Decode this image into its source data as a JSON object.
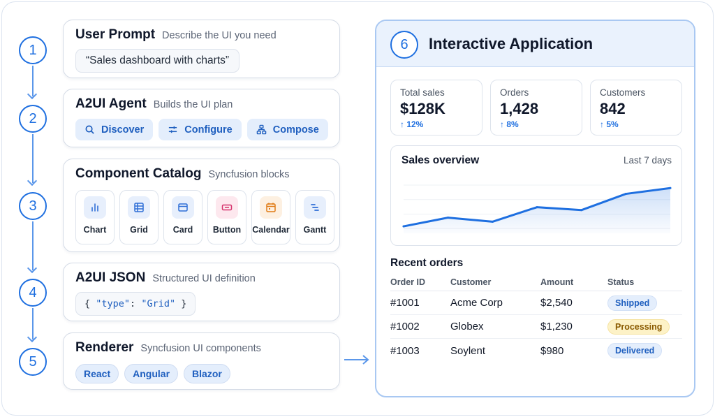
{
  "steps": [
    "1",
    "2",
    "3",
    "4",
    "5",
    "6"
  ],
  "user_prompt": {
    "title": "User Prompt",
    "subtitle": "Describe the UI you need",
    "prompt": "“Sales dashboard with charts”"
  },
  "agent": {
    "title": "A2UI Agent",
    "subtitle": "Builds the UI plan",
    "actions": [
      {
        "label": "Discover",
        "icon": "search-icon"
      },
      {
        "label": "Configure",
        "icon": "sliders-icon"
      },
      {
        "label": "Compose",
        "icon": "hierarchy-icon"
      }
    ]
  },
  "catalog": {
    "title": "Component Catalog",
    "subtitle": "Syncfusion blocks",
    "items": [
      {
        "label": "Chart",
        "icon": "bar-chart-icon",
        "color": "#2f6fd6",
        "bg": "#e7effc"
      },
      {
        "label": "Grid",
        "icon": "table-icon",
        "color": "#2f6fd6",
        "bg": "#e7effc"
      },
      {
        "label": "Card",
        "icon": "card-icon",
        "color": "#2f6fd6",
        "bg": "#e7effc"
      },
      {
        "label": "Button",
        "icon": "button-icon",
        "color": "#d6336c",
        "bg": "#fde8ee"
      },
      {
        "label": "Calendar",
        "icon": "calendar-icon",
        "color": "#e07b15",
        "bg": "#fdf0e1"
      },
      {
        "label": "Gantt",
        "icon": "gantt-icon",
        "color": "#2f6fd6",
        "bg": "#e7effc"
      }
    ]
  },
  "json_step": {
    "title": "A2UI JSON",
    "subtitle": "Structured UI definition",
    "code_open": "{ ",
    "code_key": "\"type\"",
    "code_colon": ": ",
    "code_value": "\"Grid\"",
    "code_close": " }"
  },
  "renderer": {
    "title": "Renderer",
    "subtitle": "Syncfusion UI components",
    "frameworks": [
      "React",
      "Angular",
      "Blazor"
    ]
  },
  "app": {
    "title": "Interactive Application",
    "kpis": [
      {
        "label": "Total sales",
        "value": "$128K",
        "delta": "↑ 12%"
      },
      {
        "label": "Orders",
        "value": "1,428",
        "delta": "↑ 8%"
      },
      {
        "label": "Customers",
        "value": "842",
        "delta": "↑ 5%"
      }
    ],
    "sales_chart": {
      "title": "Sales overview",
      "range": "Last 7 days"
    },
    "orders": {
      "title": "Recent orders",
      "columns": [
        "Order ID",
        "Customer",
        "Amount",
        "Status"
      ],
      "rows": [
        {
          "id": "#1001",
          "customer": "Acme Corp",
          "amount": "$2,540",
          "status": "Shipped",
          "status_color": "blue"
        },
        {
          "id": "#1002",
          "customer": "Globex",
          "amount": "$1,230",
          "status": "Processing",
          "status_color": "yellow"
        },
        {
          "id": "#1003",
          "customer": "Soylent",
          "amount": "$980",
          "status": "Delivered",
          "status_color": "blue"
        }
      ]
    }
  },
  "chart_data": {
    "type": "area",
    "title": "Sales overview",
    "x": [
      1,
      2,
      3,
      4,
      5,
      6,
      7
    ],
    "values": [
      12,
      27,
      20,
      45,
      40,
      68,
      78
    ],
    "ylim": [
      0,
      100
    ],
    "grid": true,
    "color": "#1e6fe0"
  },
  "colors": {
    "accent": "#1e6fe0",
    "chip_bg": "#e4eefc",
    "panel_header_bg": "#eaf2fd",
    "processing_badge": "#fdf2c7"
  }
}
